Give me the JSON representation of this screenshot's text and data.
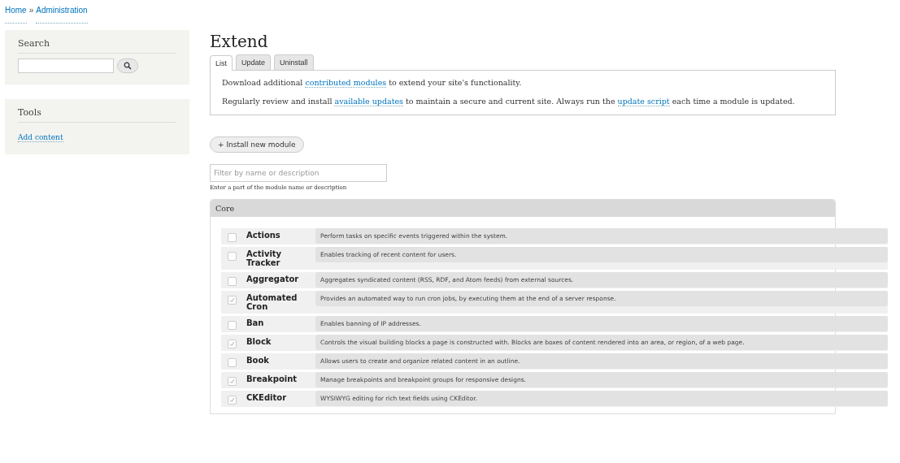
{
  "breadcrumb": [
    {
      "label": "Home"
    },
    {
      "separator": "»"
    },
    {
      "label": "Administration"
    }
  ],
  "sidebar": [
    {
      "title": "Search",
      "kind": "search"
    },
    {
      "title": "Tools",
      "kind": "links",
      "links": [
        "Add content"
      ]
    }
  ],
  "page_title": "Extend",
  "tabs": [
    {
      "label": "List",
      "selected": true
    },
    {
      "label": "Update",
      "selected": false
    },
    {
      "label": "Uninstall",
      "selected": false
    }
  ],
  "intro": [
    [
      {
        "text": "Download additional "
      },
      {
        "text": "contributed modules",
        "link": true
      },
      {
        "text": " to extend your site's functionality."
      }
    ],
    [
      {
        "text": "Regularly review and install "
      },
      {
        "text": "available updates",
        "link": true
      },
      {
        "text": " to maintain a secure and current site. Always run the "
      },
      {
        "text": "update script",
        "link": true
      },
      {
        "text": " each time a module is updated."
      }
    ]
  ],
  "install_button": "+ Install new module",
  "filter": {
    "placeholder": "Filter by name or description",
    "hint": "Enter a part of the module name or description"
  },
  "package": {
    "title": "Core",
    "modules": [
      {
        "name": "Actions",
        "description": "Perform tasks on specific events triggered within the system.",
        "checked": false
      },
      {
        "name": "Activity Tracker",
        "description": "Enables tracking of recent content for users.",
        "checked": false
      },
      {
        "name": "Aggregator",
        "description": "Aggregates syndicated content (RSS, RDF, and Atom feeds) from external sources.",
        "checked": false
      },
      {
        "name": "Automated Cron",
        "description": "Provides an automated way to run cron jobs, by executing them at the end of a server response.",
        "checked": true
      },
      {
        "name": "Ban",
        "description": "Enables banning of IP addresses.",
        "checked": false
      },
      {
        "name": "Block",
        "description": "Controls the visual building blocks a page is constructed with. Blocks are boxes of content rendered into an area, or region, of a web page.",
        "checked": true
      },
      {
        "name": "Book",
        "description": "Allows users to create and organize related content in an outline.",
        "checked": false
      },
      {
        "name": "Breakpoint",
        "description": "Manage breakpoints and breakpoint groups for responsive designs.",
        "checked": true
      },
      {
        "name": "CKEditor",
        "description": "WYSIWYG editing for rich text fields using CKEditor.",
        "checked": true
      }
    ]
  }
}
